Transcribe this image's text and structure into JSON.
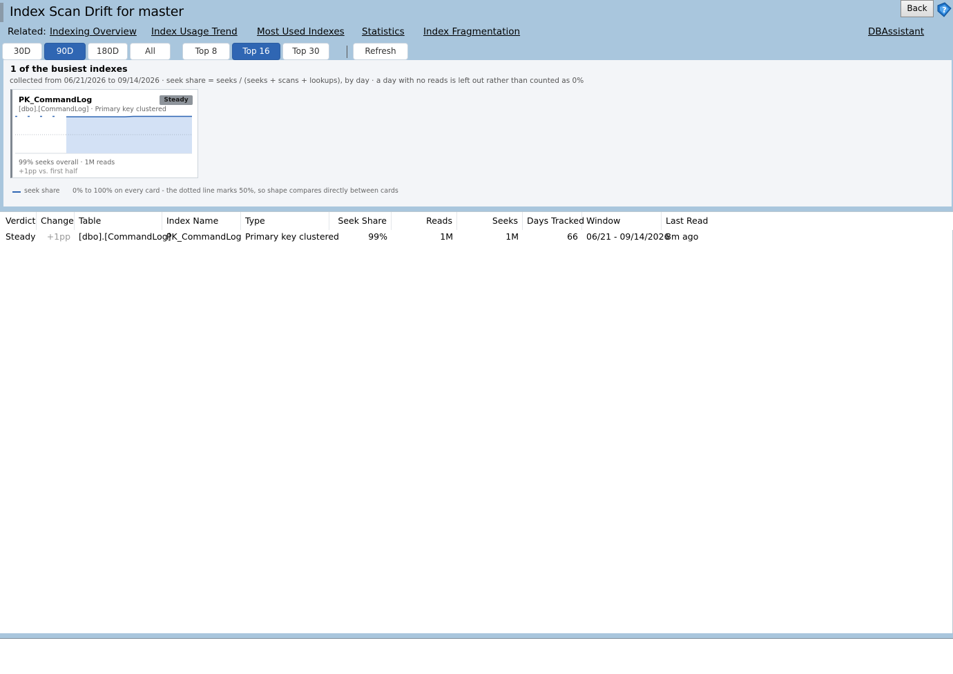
{
  "header": {
    "title": "Index Scan Drift for master",
    "back_label": "Back",
    "help_icon": "help-icon"
  },
  "related": {
    "label": "Related:",
    "links": [
      "Indexing Overview",
      "Index Usage Trend",
      "Most Used Indexes",
      "Statistics",
      "Index Fragmentation"
    ],
    "dbassistant": "DBAssistant"
  },
  "toolbar": {
    "periods": [
      "30D",
      "90D",
      "180D",
      "All"
    ],
    "active_period": "90D",
    "tops": [
      "Top 8",
      "Top 16",
      "Top 30"
    ],
    "active_top": "Top 16",
    "refresh": "Refresh"
  },
  "summary": {
    "heading": "1 of the busiest indexes",
    "subtitle": "collected from 06/21/2026 to 09/14/2026   ·   seek share = seeks / (seeks + scans + lookups), by day   ·   a day with no reads is left out rather than counted as 0%",
    "legend_label": "seek share",
    "legend_note": "0% to 100% on every card - the dotted line marks 50%, so shape compares directly between cards"
  },
  "cards": [
    {
      "name": "PK_CommandLog",
      "badge": "Steady",
      "meta": "[dbo].[CommandLog]   ·   Primary key clustered",
      "stats": "99% seeks overall   ·   1M reads",
      "delta": "+1pp vs. first half",
      "series": {
        "sparse_values": [
          0.99,
          0.99,
          0.99,
          0.99
        ],
        "dense_values": [
          0.98,
          0.98,
          0.98,
          0.98,
          0.98,
          0.98,
          0.98,
          0.98,
          0.99,
          0.99,
          0.99,
          0.99,
          0.99,
          0.99,
          0.99,
          0.99
        ],
        "ylim": [
          0,
          1
        ],
        "midline": 0.5
      }
    }
  ],
  "colors": {
    "accent": "#2f66b3",
    "header_bg": "#a9c6dd",
    "panel_bg": "#f3f5f8",
    "badge": "#8e949b"
  },
  "grid": {
    "columns": [
      "Verdict",
      "Change",
      "Table",
      "Index Name",
      "Type",
      "Seek Share",
      "Reads",
      "Seeks",
      "Days Tracked",
      "Window",
      "Last Read"
    ],
    "rows": [
      [
        "Steady",
        "+1pp",
        "[dbo].[CommandLog]",
        "PK_CommandLog",
        "Primary key clustered",
        "99%",
        "1M",
        "1M",
        "66",
        "06/21 - 09/14/2026",
        "8m ago"
      ]
    ]
  }
}
